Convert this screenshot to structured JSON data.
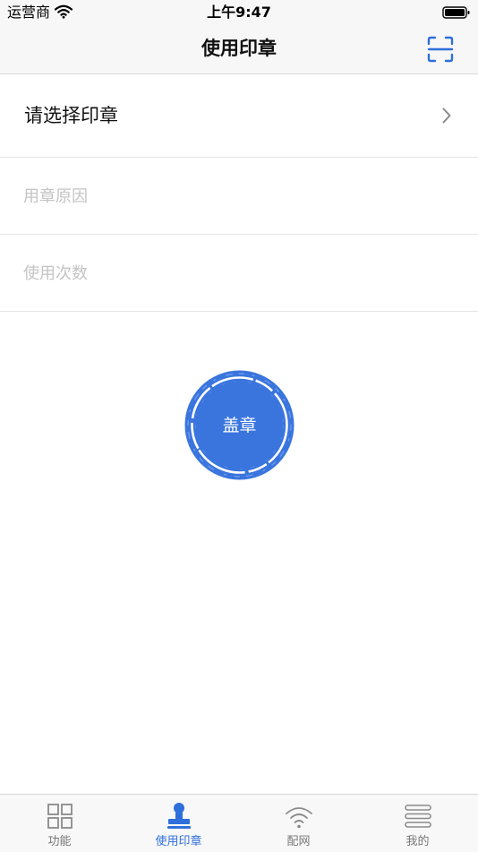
{
  "status_bar": {
    "carrier": "运营商",
    "time": "上午9:47",
    "wifi_icon": "wifi-icon",
    "battery_icon": "battery-icon"
  },
  "nav": {
    "title": "使用印章",
    "scan_icon": "scan-icon"
  },
  "form": {
    "select_seal": {
      "label": "请选择印章",
      "icon": "chevron-right-icon"
    },
    "reason": {
      "value": "",
      "placeholder": "用章原因"
    },
    "count": {
      "value": "",
      "placeholder": "使用次数"
    }
  },
  "stamp_button": {
    "label": "盖章",
    "icon": "seal-stamp-icon"
  },
  "tabs": [
    {
      "label": "功能",
      "icon": "grid-icon",
      "active": false
    },
    {
      "label": "使用印章",
      "icon": "stamp-icon",
      "active": true
    },
    {
      "label": "配网",
      "icon": "wifi-icon",
      "active": false
    },
    {
      "label": "我的",
      "icon": "menu-lines-icon",
      "active": false
    }
  ],
  "colors": {
    "accent": "#2f6fdb",
    "stamp": "#3a75de",
    "tab_inactive": "#777777",
    "placeholder": "#c4c4c4",
    "bar_background": "#f7f7f7"
  }
}
